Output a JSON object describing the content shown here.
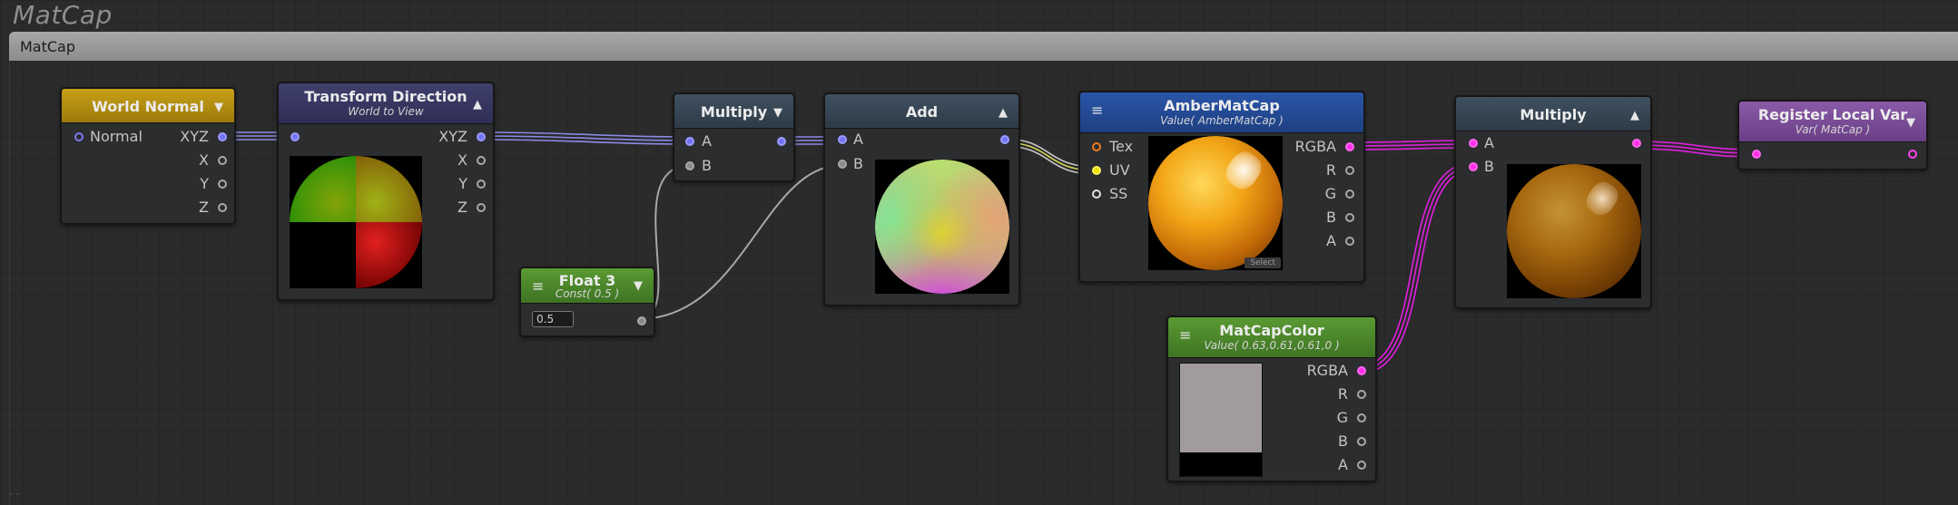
{
  "canvas": {
    "title": "MatCap"
  },
  "group": {
    "title": "MatCap"
  },
  "corner_glyph": "- -",
  "nodes": {
    "world_normal": {
      "title": "World Normal",
      "in_port": "Normal",
      "out_ports": [
        "XYZ",
        "X",
        "Y",
        "Z"
      ],
      "color": "#c9a01a"
    },
    "transform_direction": {
      "title": "Transform Direction",
      "subtitle": "World to View",
      "out_ports": [
        "XYZ",
        "X",
        "Y",
        "Z"
      ],
      "color": "#40406e"
    },
    "multiply_1": {
      "title": "Multiply",
      "in_ports": [
        "A",
        "B"
      ],
      "color": "#3f5060"
    },
    "float3": {
      "title": "Float 3",
      "subtitle": "Const( 0.5 )",
      "value": "0.5",
      "color": "#5a9a33"
    },
    "add": {
      "title": "Add",
      "in_ports": [
        "A",
        "B"
      ],
      "color": "#3f5060"
    },
    "amber_matcap": {
      "title": "AmberMatCap",
      "subtitle": "Value( AmberMatCap )",
      "in_ports": [
        "Tex",
        "UV",
        "SS"
      ],
      "out_ports": [
        "RGBA",
        "R",
        "G",
        "B",
        "A"
      ],
      "select_label": "Select",
      "color": "#2a56a8"
    },
    "matcap_color": {
      "title": "MatCapColor",
      "subtitle": "Value( 0.63,0.61,0.61,0 )",
      "out_ports": [
        "RGBA",
        "R",
        "G",
        "B",
        "A"
      ],
      "swatch": "#a19b9b",
      "color": "#5a9a33"
    },
    "multiply_2": {
      "title": "Multiply",
      "in_ports": [
        "A",
        "B"
      ],
      "color": "#3f5060"
    },
    "register_local_var": {
      "title": "Register Local Var",
      "subtitle": "Var( MatCap )",
      "color": "#8a5aa8"
    }
  },
  "icons": {
    "collapse_down": "▼",
    "collapse_up": "▲",
    "menu": "≡"
  },
  "wire_colors": {
    "vector": "#8a8ae6",
    "float": "#a8a8a8",
    "uv": "#d8d85a",
    "color": "#e020e0"
  }
}
